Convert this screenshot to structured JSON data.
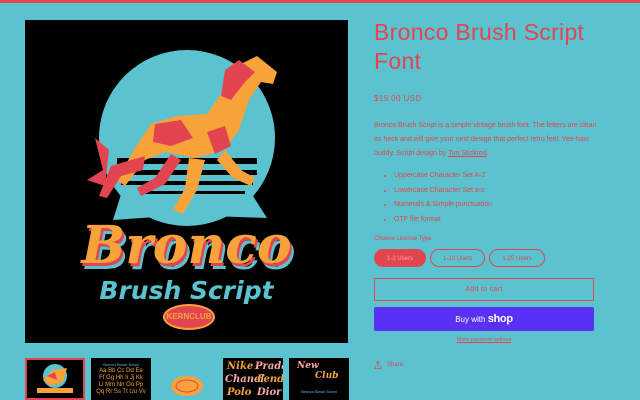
{
  "product": {
    "title": "Bronco Brush Script Font",
    "price": "$15.00 USD",
    "description_text": "Bronco Brush Script is a simple vintage brush font. The letters are clean as heck and will give your next design that perfect retro feel. Yee-haw buddy. Script design by ",
    "designer_link": "Tim Stickrod",
    "description_end": ".",
    "features": [
      "Uppercase Character Set A-Z",
      "Lowercase Character Set a-z",
      "Numerals & Simple punctuation",
      "OTF file format"
    ],
    "license_label": "Choose License Type",
    "license_options": [
      "1-2 Users",
      "1-10 Users",
      "1-25 Users"
    ],
    "add_to_cart": "Add to cart",
    "buy_with": "Buy with",
    "shop_word": "shop",
    "more_payment": "More payment options",
    "share": "Share"
  },
  "artwork": {
    "title_line1": "Bronco",
    "title_line2": "Brush Script",
    "badge": "KERNCLUB"
  },
  "thumbnails": {
    "t2_lines": [
      "Bronco Brush Script",
      "Aa Bb Cc Dd Ee",
      "Ff Gg Hh Ii Jj Kk",
      "Ll Mm Nn Oo Pp",
      "Qq Rr Ss Tt Uu Vv"
    ],
    "t4_words": [
      "Nike",
      "Prada",
      "Chanel",
      "Fendi",
      "Polo",
      "Dior"
    ],
    "t5_lines": [
      "New",
      "Club",
      "Bronco Brush Script"
    ]
  },
  "colors": {
    "background": "#5bc3cf",
    "accent": "#e2454f",
    "orange": "#f7a33a",
    "shop_pay": "#5a31f4"
  },
  "icons": {
    "share": "share-icon"
  }
}
